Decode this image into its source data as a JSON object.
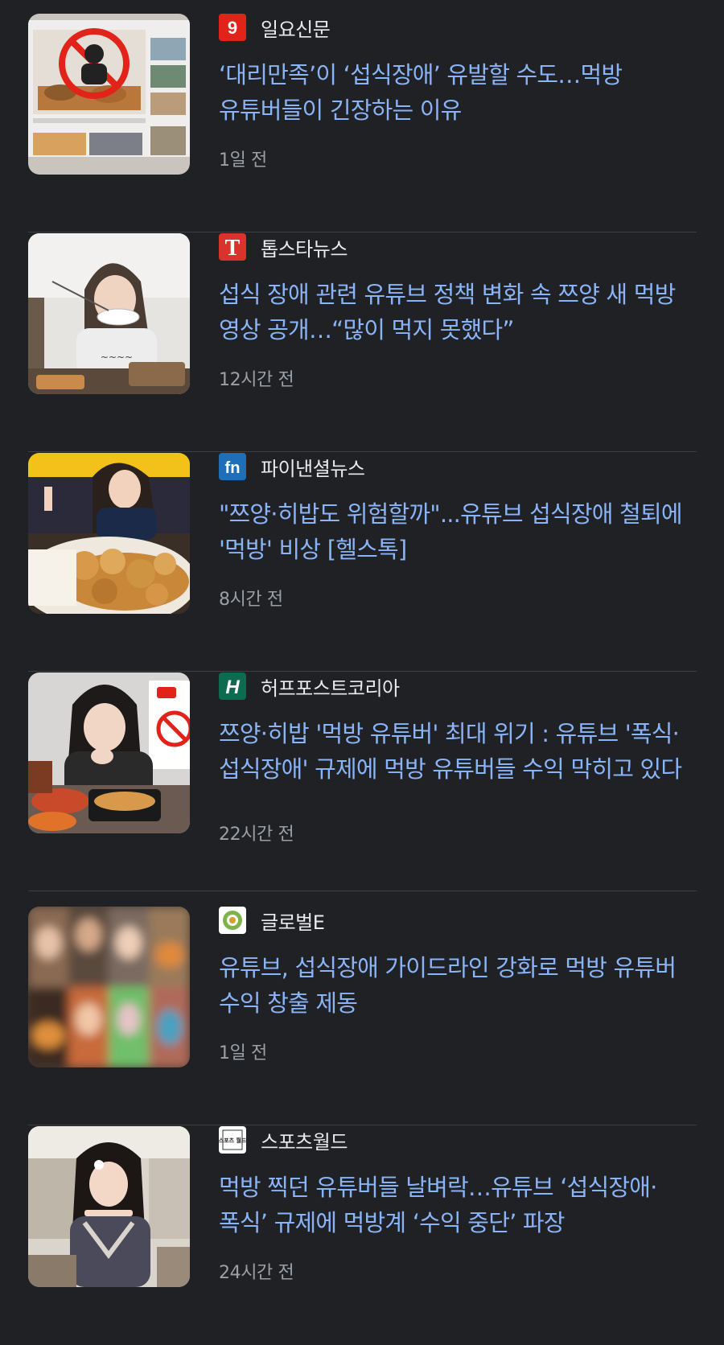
{
  "articles": [
    {
      "source": "일요신문",
      "logo_icon": "ilyo-logo-icon",
      "headline": "‘대리만족’이 ‘섭식장애’ 유발할 수도…먹방 유튜버들이 긴장하는 이유",
      "time": "1일 전"
    },
    {
      "source": "톱스타뉴스",
      "logo_icon": "topstar-logo-icon",
      "headline": "섭식 장애 관련 유튜브 정책 변화 속 쯔양 새 먹방 영상 공개…“많이 먹지 못했다”",
      "time": "12시간 전"
    },
    {
      "source": "파이낸셜뉴스",
      "logo_icon": "fn-logo-icon",
      "headline": "\"쯔양·히밥도 위험할까\"...유튜브 섭식장애 철퇴에 '먹방' 비상 [헬스톡]",
      "time": "8시간 전"
    },
    {
      "source": "허프포스트코리아",
      "logo_icon": "huffpost-logo-icon",
      "headline": "쯔양·히밥 '먹방 유튜버' 최대 위기 : 유튜브 '폭식·섭식장애' 규제에 먹방 유튜버들 수익 막히고 있다",
      "time": "22시간 전"
    },
    {
      "source": "글로벌E",
      "logo_icon": "globale-logo-icon",
      "headline": "유튜브, 섭식장애 가이드라인 강화로 먹방 유튜버 수익 창출 제동",
      "time": "1일 전"
    },
    {
      "source": "스포츠월드",
      "logo_icon": "sportsworld-logo-icon",
      "headline": "먹방 찍던 유튜버들 날벼락…유튜브 ‘섭식장애·폭식’ 규제에 먹방계 ‘수익 중단’ 파장",
      "time": "24시간 전"
    }
  ],
  "logo_texts": {
    "ilyo": "9",
    "topstar": "T",
    "fn": "fn",
    "huffpost": "H",
    "sportsworld": "스포츠 월드"
  },
  "colors": {
    "background": "#202124",
    "headline": "#8ab4f8",
    "source": "#e8eaed",
    "time": "#9aa0a6",
    "divider": "#3c4043"
  }
}
